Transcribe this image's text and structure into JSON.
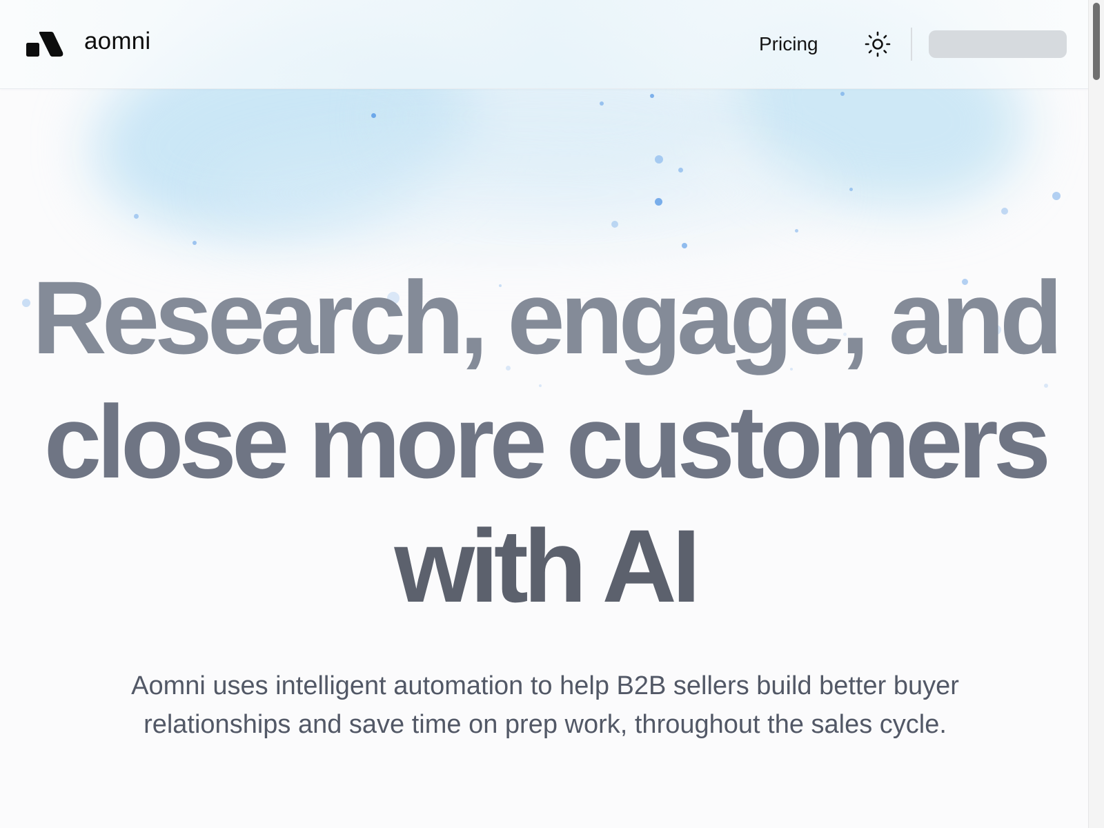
{
  "header": {
    "brand": "aomni",
    "nav": {
      "pricing_label": "Pricing"
    },
    "theme_icon": "sun-icon",
    "account_placeholder": "loading-placeholder"
  },
  "hero": {
    "title_lines": [
      "Research, engage, and",
      "close more customers",
      "with AI"
    ],
    "subtitle_lines": [
      "Aomni uses intelligent automation to help B2B sellers build better buyer",
      "relationships and save time on prep work, throughout the sales cycle."
    ]
  },
  "colors": {
    "background": "#fbfbfc",
    "title_top": "#848b98",
    "title_bottom": "#5c616d",
    "subtitle": "#525866",
    "haze": "#b0dcf2",
    "particles": "#5b9be6"
  }
}
